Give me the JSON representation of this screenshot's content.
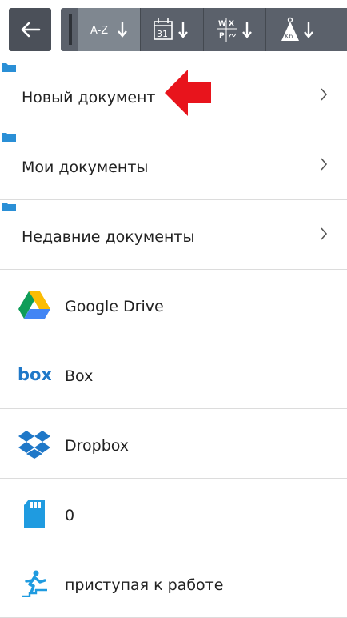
{
  "toolbar": {
    "back_icon": "back-arrow-icon",
    "sort_buttons": [
      {
        "label": "A-Z",
        "icon": "sort-alpha-icon",
        "active": true
      },
      {
        "label": "31",
        "icon": "sort-date-icon",
        "active": false
      },
      {
        "label": "W X P",
        "icon": "sort-type-icon",
        "active": false
      },
      {
        "label": "Kb",
        "icon": "sort-size-icon",
        "active": false
      }
    ]
  },
  "folders": [
    {
      "label": "Новый документ",
      "icon": "folder-icon"
    },
    {
      "label": "Мои документы",
      "icon": "folder-icon"
    },
    {
      "label": "Недавние документы",
      "icon": "folder-icon"
    }
  ],
  "services": [
    {
      "label": "Google Drive",
      "icon": "google-drive-icon"
    },
    {
      "label": "Box",
      "icon": "box-icon"
    },
    {
      "label": "Dropbox",
      "icon": "dropbox-icon"
    },
    {
      "label": "0",
      "icon": "sd-card-icon"
    },
    {
      "label": "приступая к работе",
      "icon": "getting-started-icon"
    }
  ],
  "colors": {
    "toolbar_bg": "#5b616b",
    "active_sort": "#7f8790",
    "folder_blue": "#2a8fd6",
    "annotation_red": "#e8141c"
  }
}
